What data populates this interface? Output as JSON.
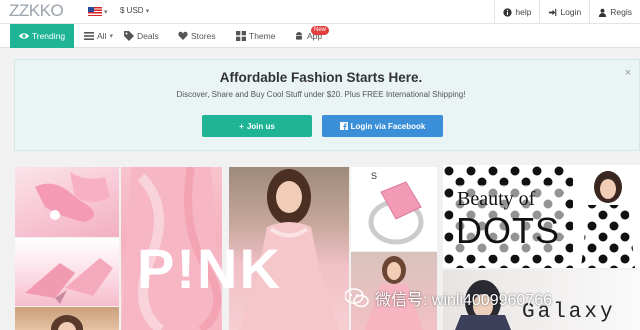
{
  "header": {
    "logo": "ZZKKO",
    "currency": "$ USD",
    "links": [
      {
        "label": "help",
        "icon": "info-icon"
      },
      {
        "label": "Login",
        "icon": "login-icon"
      },
      {
        "label": "Regis",
        "icon": "user-icon"
      }
    ]
  },
  "nav": {
    "items": [
      {
        "label": "Trending",
        "icon": "eye-icon"
      },
      {
        "label": "All",
        "icon": "list-icon"
      },
      {
        "label": "Deals",
        "icon": "tag-icon"
      },
      {
        "label": "Stores",
        "icon": "heart-icon"
      },
      {
        "label": "Theme",
        "icon": "grid-icon"
      },
      {
        "label": "App",
        "icon": "android-icon"
      }
    ],
    "new_badge": "New"
  },
  "banner": {
    "title": "Affordable Fashion Starts Here.",
    "subtitle": "Discover, Share and Buy Cool Stuff under $20. Plus FREE International Shipping!",
    "join_label": "Join us",
    "facebook_label": "Login via Facebook",
    "close": "×"
  },
  "feed": {
    "pink_text": "P!NK",
    "beauty_text": "Beauty of",
    "dots_text": "DOTS",
    "galaxy_text": "Galaxy"
  },
  "watermark": {
    "text": "微信号: winli4009960766"
  },
  "colors": {
    "accent": "#1fb496",
    "facebook": "#3a8fd8",
    "badge": "#e23e3e"
  }
}
